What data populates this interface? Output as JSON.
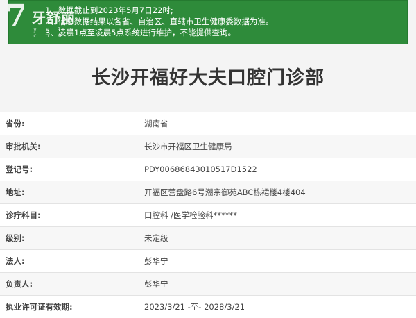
{
  "logo": {
    "mark": "7",
    "text": "牙舒丽",
    "sub": "y s l w . c o m"
  },
  "notice": {
    "lines": [
      "1、数据截止到2023年5月7日22时;",
      "2、信息数据结果以各省、自治区、直辖市卫生健康委数据为准。",
      "3、凌晨1点至凌晨5点系统进行维护，不能提供查询。"
    ]
  },
  "title": "长沙开福好大夫口腔门诊部",
  "details": [
    {
      "label": "省份:",
      "value": "湖南省"
    },
    {
      "label": "审批机关:",
      "value": "长沙市开福区卫生健康局"
    },
    {
      "label": "登记号:",
      "value": "PDY00686843010517D1522"
    },
    {
      "label": "地址:",
      "value": "开福区营盘路6号潮宗御苑ABC栋裙楼4楼404"
    },
    {
      "label": "诊疗科目:",
      "value": "口腔科 /医学检验科******"
    },
    {
      "label": "级别:",
      "value": "未定级"
    },
    {
      "label": "法人:",
      "value": "彭华宁"
    },
    {
      "label": "负责人:",
      "value": "彭华宁"
    },
    {
      "label": "执业许可证有效期:",
      "value": "2023/3/21 -至- 2028/3/21"
    }
  ]
}
